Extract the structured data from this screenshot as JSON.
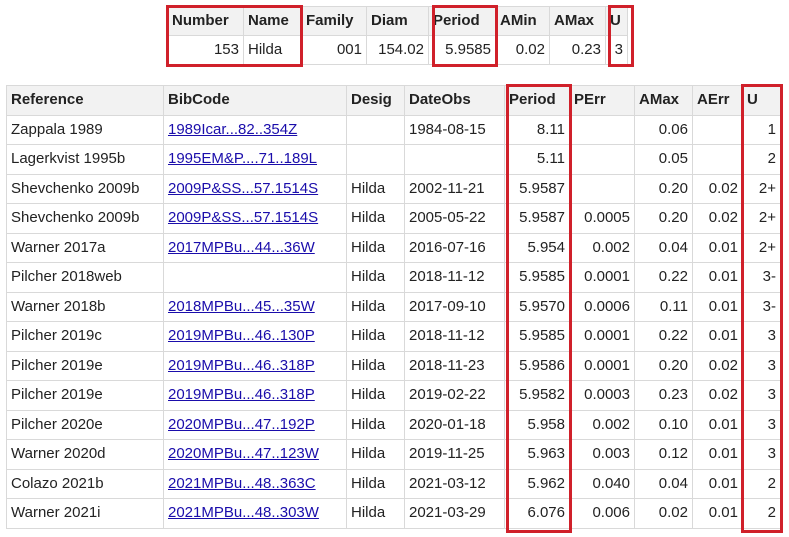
{
  "summary": {
    "headers": [
      "Number",
      "Name",
      "Family",
      "Diam",
      "Period",
      "AMin",
      "AMax",
      "U"
    ],
    "row": [
      "153",
      "Hilda",
      "001",
      "154.02",
      "5.9585",
      "0.02",
      "0.23",
      "3"
    ]
  },
  "observations": {
    "headers": [
      "Reference",
      "BibCode",
      "Desig",
      "DateObs",
      "Period",
      "PErr",
      "AMax",
      "AErr",
      "U"
    ],
    "rows": [
      [
        "Zappala 1989",
        "1989Icar...82..354Z",
        "",
        "1984-08-15",
        "8.11",
        "",
        "0.06",
        "",
        "1"
      ],
      [
        "Lagerkvist 1995b",
        "1995EM&P....71..189L",
        "",
        "",
        "5.11",
        "",
        "0.05",
        "",
        "2"
      ],
      [
        "Shevchenko 2009b",
        "2009P&SS...57.1514S",
        "Hilda",
        "2002-11-21",
        "5.9587",
        "",
        "0.20",
        "0.02",
        "2+"
      ],
      [
        "Shevchenko 2009b",
        "2009P&SS...57.1514S",
        "Hilda",
        "2005-05-22",
        "5.9587",
        "0.0005",
        "0.20",
        "0.02",
        "2+"
      ],
      [
        "Warner 2017a",
        "2017MPBu...44...36W",
        "Hilda",
        "2016-07-16",
        "5.954",
        "0.002",
        "0.04",
        "0.01",
        "2+"
      ],
      [
        "Pilcher 2018web",
        "",
        "Hilda",
        "2018-11-12",
        "5.9585",
        "0.0001",
        "0.22",
        "0.01",
        "3-"
      ],
      [
        "Warner 2018b",
        "2018MPBu...45...35W",
        "Hilda",
        "2017-09-10",
        "5.9570",
        "0.0006",
        "0.11",
        "0.01",
        "3-"
      ],
      [
        "Pilcher 2019c",
        "2019MPBu...46..130P",
        "Hilda",
        "2018-11-12",
        "5.9585",
        "0.0001",
        "0.22",
        "0.01",
        "3"
      ],
      [
        "Pilcher 2019e",
        "2019MPBu...46..318P",
        "Hilda",
        "2018-11-23",
        "5.9586",
        "0.0001",
        "0.20",
        "0.02",
        "3"
      ],
      [
        "Pilcher 2019e",
        "2019MPBu...46..318P",
        "Hilda",
        "2019-02-22",
        "5.9582",
        "0.0003",
        "0.23",
        "0.02",
        "3"
      ],
      [
        "Pilcher 2020e",
        "2020MPBu...47..192P",
        "Hilda",
        "2020-01-18",
        "5.958",
        "0.002",
        "0.10",
        "0.01",
        "3"
      ],
      [
        "Warner 2020d",
        "2020MPBu...47..123W",
        "Hilda",
        "2019-11-25",
        "5.963",
        "0.003",
        "0.12",
        "0.01",
        "3"
      ],
      [
        "Colazo 2021b",
        "2021MPBu...48..363C",
        "Hilda",
        "2021-03-12",
        "5.962",
        "0.040",
        "0.04",
        "0.01",
        "2"
      ],
      [
        "Warner 2021i",
        "2021MPBu...48..303W",
        "Hilda",
        "2021-03-29",
        "6.076",
        "0.006",
        "0.02",
        "0.01",
        "2"
      ]
    ]
  },
  "highlight_color": "#d0202a"
}
